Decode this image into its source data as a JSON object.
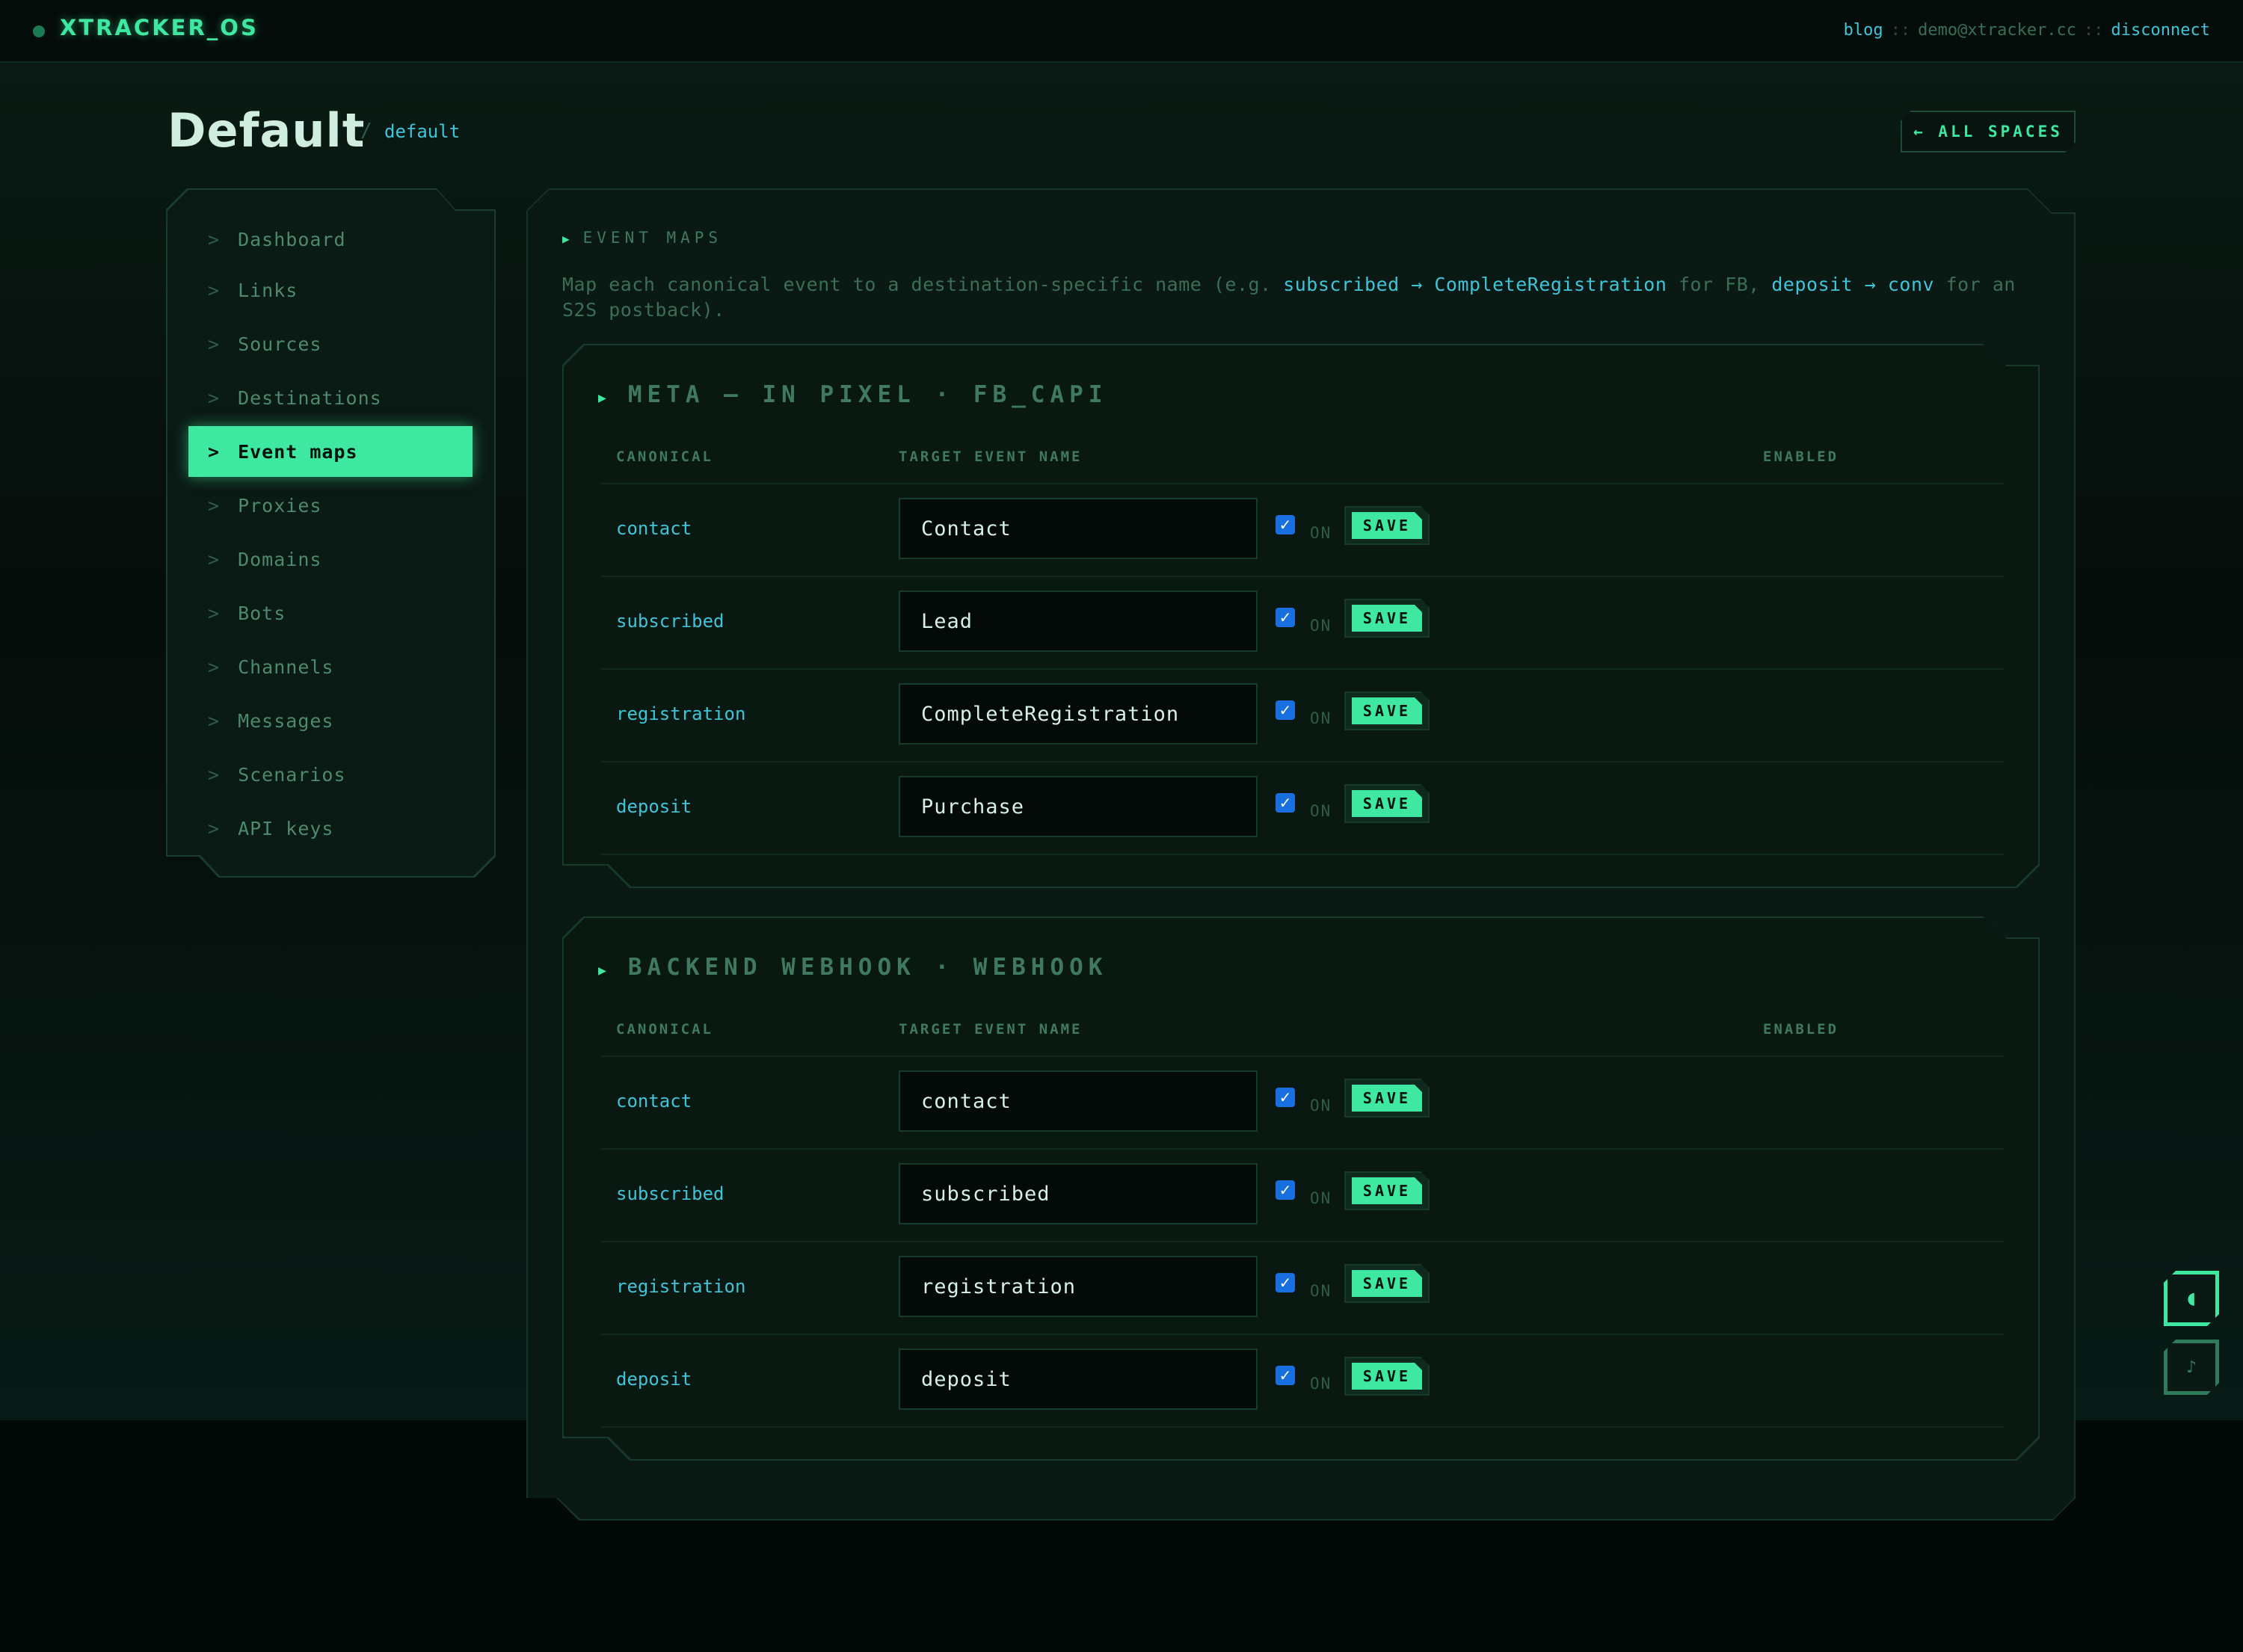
{
  "app": {
    "brand": "XTRACKER_OS",
    "nav_blog": "blog",
    "nav_sep": "::",
    "user_email": "demo@xtracker.cc",
    "nav_disconnect": "disconnect"
  },
  "header": {
    "title": "Default",
    "breadcrumb_sep": "/",
    "breadcrumb": "default",
    "all_spaces": "← ALL SPACES"
  },
  "sidebar": {
    "items": [
      {
        "label": "Dashboard",
        "active": false
      },
      {
        "label": "Links",
        "active": false
      },
      {
        "label": "Sources",
        "active": false
      },
      {
        "label": "Destinations",
        "active": false
      },
      {
        "label": "Event maps",
        "active": true
      },
      {
        "label": "Proxies",
        "active": false
      },
      {
        "label": "Domains",
        "active": false
      },
      {
        "label": "Bots",
        "active": false
      },
      {
        "label": "Channels",
        "active": false
      },
      {
        "label": "Messages",
        "active": false
      },
      {
        "label": "Scenarios",
        "active": false
      },
      {
        "label": "API keys",
        "active": false
      }
    ],
    "chevron": ">"
  },
  "main": {
    "heading": "EVENT MAPS",
    "description": {
      "p1": "Map each canonical event to a destination-specific name (e.g. ",
      "h1": "subscribed → CompleteRegistration",
      "p2": " for FB, ",
      "h2": "deposit → conv",
      "p3": " for an S2S postback)."
    },
    "columns": {
      "canonical": "CANONICAL",
      "target": "TARGET EVENT NAME",
      "enabled": "ENABLED"
    },
    "on_label": "ON",
    "save_label": "SAVE",
    "destinations": [
      {
        "title": "META — IN PIXEL · FB_CAPI",
        "rows": [
          {
            "canonical": "contact",
            "target": "Contact",
            "enabled": true
          },
          {
            "canonical": "subscribed",
            "target": "Lead",
            "enabled": true
          },
          {
            "canonical": "registration",
            "target": "CompleteRegistration",
            "enabled": true
          },
          {
            "canonical": "deposit",
            "target": "Purchase",
            "enabled": true
          }
        ]
      },
      {
        "title": "BACKEND WEBHOOK · WEBHOOK",
        "rows": [
          {
            "canonical": "contact",
            "target": "contact",
            "enabled": true
          },
          {
            "canonical": "subscribed",
            "target": "subscribed",
            "enabled": true
          },
          {
            "canonical": "registration",
            "target": "registration",
            "enabled": true
          },
          {
            "canonical": "deposit",
            "target": "deposit",
            "enabled": true
          }
        ]
      }
    ]
  },
  "floating": {
    "theme_icon": "◖",
    "sound_icon": "♪"
  },
  "colors": {
    "accent": "#3ee8a0",
    "link": "#3fc4d8",
    "checkbox": "#1a6fe0"
  }
}
